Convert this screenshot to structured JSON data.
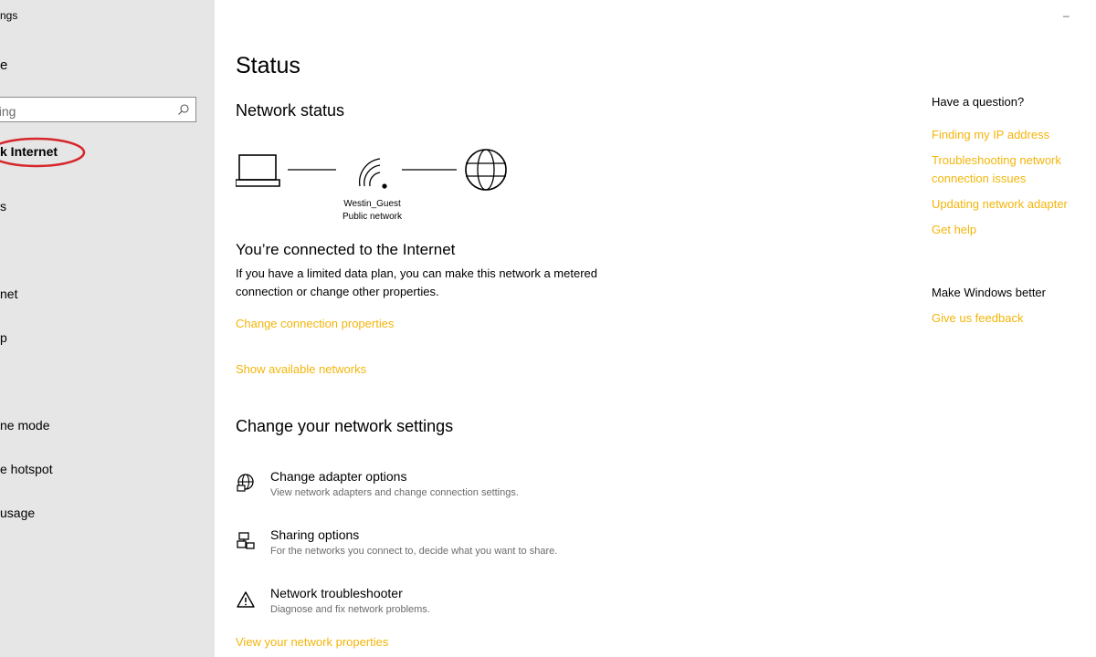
{
  "sidebar": {
    "title": "ngs",
    "home": "e",
    "search": {
      "value": "tting"
    },
    "selected": "k Internet",
    "items": [
      "s",
      "",
      "net",
      "p",
      "",
      "ne mode",
      "e hotspot",
      "usage"
    ]
  },
  "main": {
    "title": "Status",
    "network_status_heading": "Network status",
    "network_name": "Westin_Guest",
    "network_type": "Public network",
    "connected_heading": "You’re connected to the Internet",
    "connected_body": "If you have a limited data plan, you can make this network a metered connection or change other properties.",
    "change_connection_link": "Change connection properties",
    "show_networks_link": "Show available networks",
    "change_settings_heading": "Change your network settings",
    "options": [
      {
        "title": "Change adapter options",
        "desc": "View network adapters and change connection settings."
      },
      {
        "title": "Sharing options",
        "desc": "For the networks you connect to, decide what you want to share."
      },
      {
        "title": "Network troubleshooter",
        "desc": "Diagnose and fix network problems."
      }
    ],
    "view_properties_link": "View your network properties"
  },
  "right": {
    "question_heading": "Have a question?",
    "links": [
      "Finding my IP address",
      "Troubleshooting network connection issues",
      "Updating network adapter",
      "Get help"
    ],
    "better_heading": "Make Windows better",
    "feedback_link": "Give us feedback"
  },
  "window": {
    "minimize": "–"
  },
  "colors": {
    "accent": "#f3b50a",
    "sidebar_bg": "#e6e6e6",
    "annotation": "#d6262b"
  },
  "icons": [
    "search-icon",
    "laptop-icon",
    "wifi-icon",
    "globe-icon",
    "adapter-icon",
    "sharing-icon",
    "warning-icon"
  ]
}
